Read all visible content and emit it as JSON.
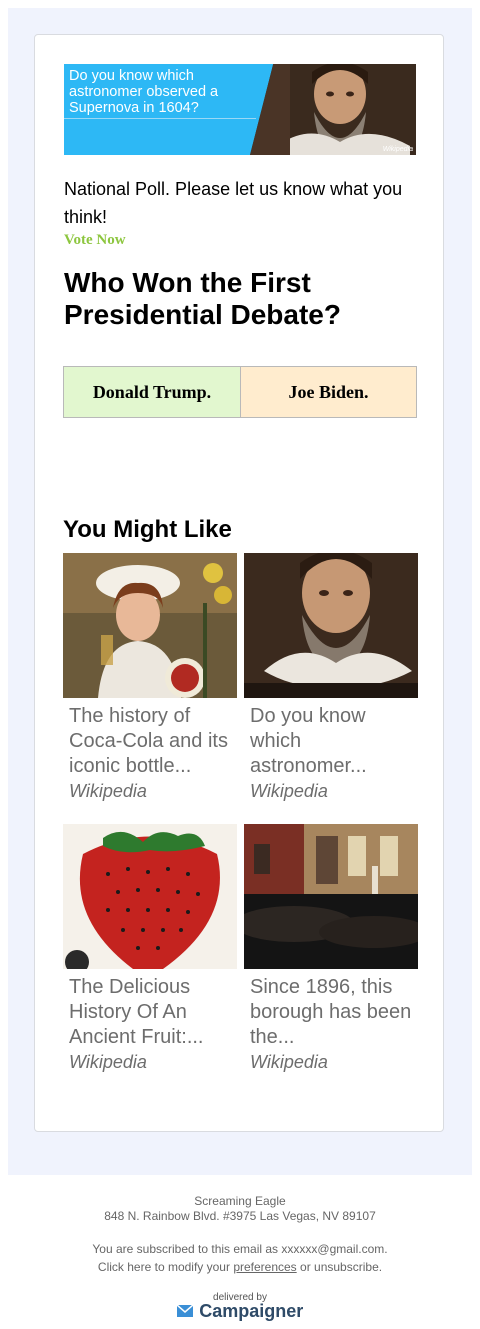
{
  "banner": {
    "text": "Do you know which astronomer observed a Supernova in 1604?",
    "source": "Wikipedia",
    "bg_color": "#2db8f5"
  },
  "poll": {
    "intro": "National Poll. Please let us know what you think!",
    "vote_label": "Vote Now",
    "question": "Who Won the First Presidential Debate?",
    "choices": [
      {
        "label": "Donald Trump.",
        "color": "#e2f7cf"
      },
      {
        "label": "Joe Biden.",
        "color": "#ffecce"
      }
    ]
  },
  "recommendations": {
    "heading": "You Might Like",
    "items": [
      {
        "title": "The history of Coca-Cola and its iconic bottle...",
        "source": "Wikipedia",
        "image": "coca-cola-vintage-ad"
      },
      {
        "title": "Do you know which astronomer...",
        "source": "Wikipedia",
        "image": "astronomer-portrait"
      },
      {
        "title": "The Delicious History Of An Ancient Fruit:...",
        "source": "Wikipedia",
        "image": "strawberry-illustration"
      },
      {
        "title": "Since 1896, this borough has been the...",
        "source": "Wikipedia",
        "image": "night-street-photo"
      }
    ]
  },
  "footer": {
    "company": "Screaming Eagle",
    "address": "848 N. Rainbow Blvd. #3975 Las Vegas, NV 89107",
    "subscribed": "You are subscribed to this email as xxxxxx@gmail.com.",
    "modify_prefix": "Click here to modify your",
    "preferences_link": "preferences",
    "modify_suffix": "or unsubscribe.",
    "delivered_by": "delivered by",
    "brand": "Campaigner"
  }
}
